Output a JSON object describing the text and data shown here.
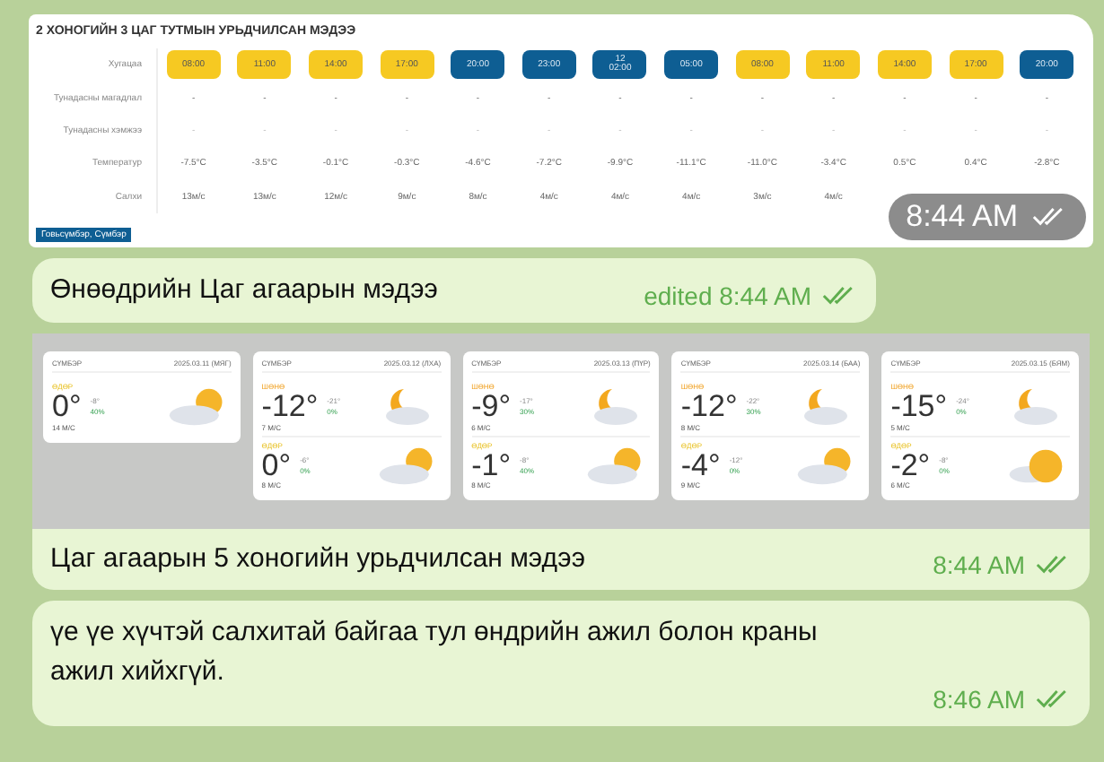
{
  "messages": [
    {
      "kind": "table_image",
      "time": "8:44 AM",
      "read": true,
      "table": {
        "title": "2 ХОНОГИЙН 3 ЦАГ ТУТМЫН УРЬДЧИЛСАН МЭДЭЭ",
        "row_labels": [
          "Хугацаа",
          "Тунадасны магадлал",
          "Тунадасны хэмжээ",
          "Температур",
          "Салхи"
        ],
        "location_tag": "Говьсүмбэр, Сүмбэр",
        "columns": [
          {
            "time": "08:00",
            "night": false,
            "precip_chance": "-",
            "precip_amount": "-",
            "temperature": "-7.5°C",
            "wind": "13м/с"
          },
          {
            "time": "11:00",
            "night": false,
            "precip_chance": "-",
            "precip_amount": "-",
            "temperature": "-3.5°C",
            "wind": "13м/с"
          },
          {
            "time": "14:00",
            "night": false,
            "precip_chance": "-",
            "precip_amount": "-",
            "temperature": "-0.1°C",
            "wind": "12м/с"
          },
          {
            "time": "17:00",
            "night": false,
            "precip_chance": "-",
            "precip_amount": "-",
            "temperature": "-0.3°C",
            "wind": "9м/с"
          },
          {
            "time": "20:00",
            "night": true,
            "precip_chance": "-",
            "precip_amount": "-",
            "temperature": "-4.6°C",
            "wind": "8м/с"
          },
          {
            "time": "23:00",
            "night": true,
            "precip_chance": "-",
            "precip_amount": "-",
            "temperature": "-7.2°C",
            "wind": "4м/с"
          },
          {
            "date": "12",
            "time": "02:00",
            "night": true,
            "precip_chance": "-",
            "precip_amount": "-",
            "temperature": "-9.9°C",
            "wind": "4м/с"
          },
          {
            "time": "05:00",
            "night": true,
            "precip_chance": "-",
            "precip_amount": "-",
            "temperature": "-11.1°C",
            "wind": "4м/с"
          },
          {
            "time": "08:00",
            "night": false,
            "precip_chance": "-",
            "precip_amount": "-",
            "temperature": "-11.0°C",
            "wind": "3м/с"
          },
          {
            "time": "11:00",
            "night": false,
            "precip_chance": "-",
            "precip_amount": "-",
            "temperature": "-3.4°C",
            "wind": "4м/с"
          },
          {
            "time": "14:00",
            "night": false,
            "precip_chance": "-",
            "precip_amount": "-",
            "temperature": "0.5°C"
          },
          {
            "time": "17:00",
            "night": false,
            "precip_chance": "-",
            "precip_amount": "-",
            "temperature": "0.4°C"
          },
          {
            "time": "20:00",
            "night": true,
            "precip_chance": "-",
            "precip_amount": "-",
            "temperature": "-2.8°C"
          }
        ]
      }
    },
    {
      "kind": "text",
      "text": "Өнөөдрийн Цаг агаарын мэдээ",
      "edited_label": "edited",
      "time": "8:44 AM",
      "read": true
    },
    {
      "kind": "cards_image",
      "caption": "Цаг агаарын 5 хоногийн урьдчилсан мэдээ",
      "time": "8:44 AM",
      "read": true,
      "cards": [
        {
          "place": "СҮМБЭР",
          "date": "2025.03.11 (МЯГ)",
          "slots": [
            {
              "period": "ӨДӨР",
              "night": false,
              "temp": "0°",
              "low": "-8°",
              "precip": "40%",
              "wind": "14 М/С",
              "kind": "sun_cloud"
            }
          ]
        },
        {
          "place": "СҮМБЭР",
          "date": "2025.03.12 (ЛХА)",
          "slots": [
            {
              "period": "ШӨНӨ",
              "night": true,
              "temp": "-12°",
              "low": "-21°",
              "precip": "0%",
              "wind": "7 М/С",
              "kind": "moon_cloud"
            },
            {
              "period": "ӨДӨР",
              "night": false,
              "temp": "0°",
              "low": "-6°",
              "precip": "0%",
              "wind": "8 М/С",
              "kind": "sun_cloud"
            }
          ]
        },
        {
          "place": "СҮМБЭР",
          "date": "2025.03.13 (ПҮР)",
          "slots": [
            {
              "period": "ШӨНӨ",
              "night": true,
              "temp": "-9°",
              "low": "-17°",
              "precip": "30%",
              "wind": "6 М/С",
              "kind": "moon_cloud"
            },
            {
              "period": "ӨДӨР",
              "night": false,
              "temp": "-1°",
              "low": "-8°",
              "precip": "40%",
              "wind": "8 М/С",
              "kind": "sun_cloud"
            }
          ]
        },
        {
          "place": "СҮМБЭР",
          "date": "2025.03.14 (БАА)",
          "slots": [
            {
              "period": "ШӨНӨ",
              "night": true,
              "temp": "-12°",
              "low": "-22°",
              "precip": "30%",
              "wind": "8 М/С",
              "kind": "moon_cloud"
            },
            {
              "period": "ӨДӨР",
              "night": false,
              "temp": "-4°",
              "low": "-12°",
              "precip": "0%",
              "wind": "9 М/С",
              "kind": "sun_cloud"
            }
          ]
        },
        {
          "place": "СҮМБЭР",
          "date": "2025.03.15 (БЯМ)",
          "slots": [
            {
              "period": "ШӨНӨ",
              "night": true,
              "temp": "-15°",
              "low": "-24°",
              "precip": "0%",
              "wind": "5 М/С",
              "kind": "moon_cloud"
            },
            {
              "period": "ӨДӨР",
              "night": false,
              "temp": "-2°",
              "low": "-8°",
              "precip": "0%",
              "wind": "6 М/С",
              "kind": "sun"
            }
          ]
        }
      ]
    },
    {
      "kind": "text",
      "text": "үе үе хүчтэй салхитай байгаа тул өндрийн ажил болон краны ажил хийхгүй.",
      "time": "8:46 AM",
      "read": true
    }
  ]
}
